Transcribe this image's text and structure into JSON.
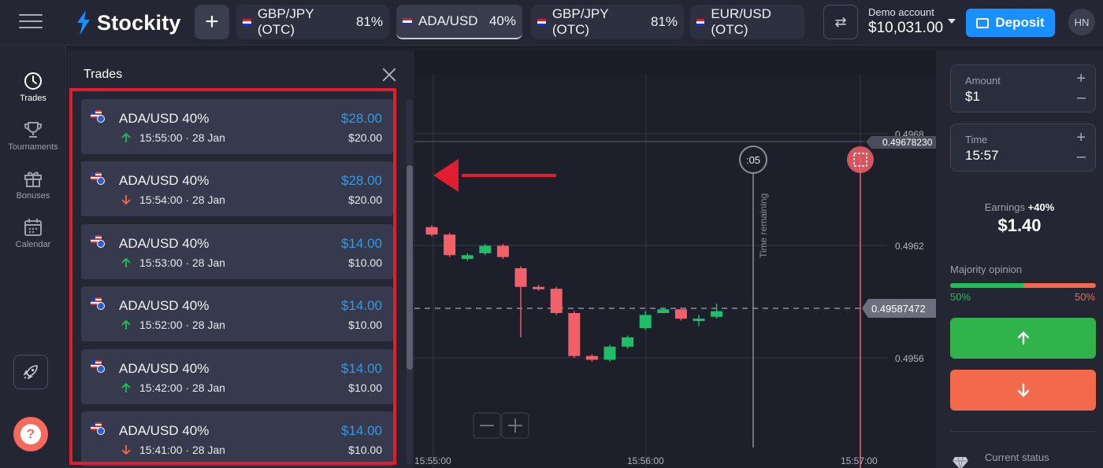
{
  "brand": {
    "name": "Stockity"
  },
  "tabs": [
    {
      "name": "GBP/JPY (OTC)",
      "pct": "81%"
    },
    {
      "name": "ADA/USD",
      "pct": "40%"
    },
    {
      "name": "GBP/JPY (OTC)",
      "pct": "81%"
    },
    {
      "name": "EUR/USD (OTC)",
      "pct": ""
    }
  ],
  "account": {
    "label": "Demo account",
    "balance": "$10,031.00"
  },
  "deposit": {
    "label": "Deposit"
  },
  "user": {
    "initials": "HN"
  },
  "sidebar": {
    "items": [
      {
        "label": "Trades",
        "icon": "clock-icon"
      },
      {
        "label": "Tournaments",
        "icon": "trophy-icon"
      },
      {
        "label": "Bonuses",
        "icon": "gift-icon"
      },
      {
        "label": "Calendar",
        "icon": "calendar-icon"
      }
    ]
  },
  "trades": {
    "title": "Trades",
    "items": [
      {
        "name": "ADA/USD 40%",
        "payout": "$28.00",
        "time": "15:55:00  ·  28 Jan",
        "stake": "$20.00",
        "direction": "up"
      },
      {
        "name": "ADA/USD 40%",
        "payout": "$28.00",
        "time": "15:54:00  ·  28 Jan",
        "stake": "$20.00",
        "direction": "down"
      },
      {
        "name": "ADA/USD 40%",
        "payout": "$14.00",
        "time": "15:53:00  ·  28 Jan",
        "stake": "$10.00",
        "direction": "up"
      },
      {
        "name": "ADA/USD 40%",
        "payout": "$14.00",
        "time": "15:52:00  ·  28 Jan",
        "stake": "$10.00",
        "direction": "up"
      },
      {
        "name": "ADA/USD 40%",
        "payout": "$14.00",
        "time": "15:42:00  ·  28 Jan",
        "stake": "$10.00",
        "direction": "up"
      },
      {
        "name": "ADA/USD 40%",
        "payout": "$14.00",
        "time": "15:41:00  ·  28 Jan",
        "stake": "$10.00",
        "direction": "down"
      }
    ]
  },
  "chart": {
    "price_labels": [
      "0.4968",
      "0.4962",
      "0.4956"
    ],
    "marker_price": "0.49678230",
    "current_price": "0.49587472",
    "time_labels": [
      "15:55:00",
      "15:56:00",
      "15:57:00"
    ],
    "timer": ":05",
    "time_remaining": "Time remaining",
    "colors": {
      "up": "#1fbf6a",
      "down": "#f2606a"
    },
    "candles": [
      {
        "o": 0.4963,
        "c": 0.49626,
        "h": 0.49631,
        "l": 0.49625
      },
      {
        "o": 0.49626,
        "c": 0.49615,
        "h": 0.49627,
        "l": 0.49614
      },
      {
        "o": 0.49613,
        "c": 0.49615,
        "h": 0.49616,
        "l": 0.49612
      },
      {
        "o": 0.49616,
        "c": 0.4962,
        "h": 0.49621,
        "l": 0.49615
      },
      {
        "o": 0.4962,
        "c": 0.49614,
        "h": 0.49621,
        "l": 0.49613
      },
      {
        "o": 0.49608,
        "c": 0.49598,
        "h": 0.49609,
        "l": 0.49571
      },
      {
        "o": 0.49598,
        "c": 0.49597,
        "h": 0.49599,
        "l": 0.49596
      },
      {
        "o": 0.49597,
        "c": 0.49584,
        "h": 0.49598,
        "l": 0.49583
      },
      {
        "o": 0.49584,
        "c": 0.49561,
        "h": 0.49585,
        "l": 0.4956
      },
      {
        "o": 0.49561,
        "c": 0.49559,
        "h": 0.49562,
        "l": 0.49558
      },
      {
        "o": 0.49559,
        "c": 0.49566,
        "h": 0.49567,
        "l": 0.49558
      },
      {
        "o": 0.49566,
        "c": 0.49571,
        "h": 0.49572,
        "l": 0.49565
      },
      {
        "o": 0.49576,
        "c": 0.49583,
        "h": 0.49585,
        "l": 0.49575
      },
      {
        "o": 0.49584,
        "c": 0.49586,
        "h": 0.49587,
        "l": 0.49584
      },
      {
        "o": 0.49586,
        "c": 0.49581,
        "h": 0.49587,
        "l": 0.4958
      },
      {
        "o": 0.4958,
        "c": 0.49581,
        "h": 0.49583,
        "l": 0.49577
      },
      {
        "o": 0.49582,
        "c": 0.49585,
        "h": 0.49589,
        "l": 0.49581
      }
    ]
  },
  "order": {
    "amount_label": "Amount",
    "amount_value": "$1",
    "time_label": "Time",
    "time_value": "15:57",
    "earnings_label": "Earnings",
    "earnings_pct": "+40%",
    "earnings_value": "$1.40",
    "majority_label": "Majority opinion",
    "majority_up": "50%",
    "majority_down": "50%",
    "majority_up_fraction": 0.5,
    "status_label": "Current status"
  }
}
